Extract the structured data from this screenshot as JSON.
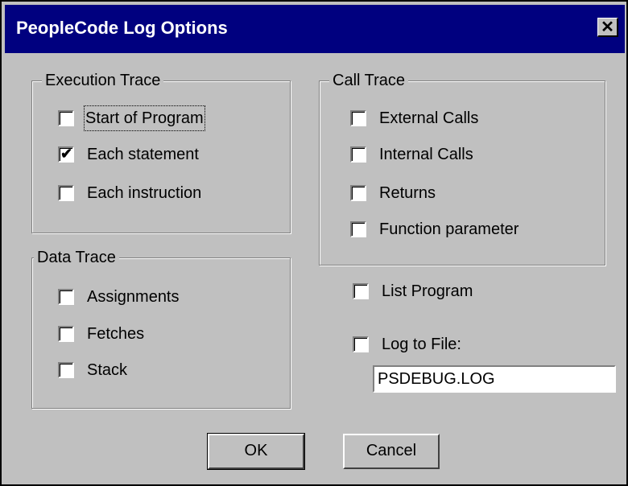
{
  "window": {
    "title": "PeopleCode Log Options",
    "close_glyph": "✕"
  },
  "execution_trace": {
    "legend": "Execution Trace",
    "items": [
      {
        "label": "Start of Program",
        "checked": false
      },
      {
        "label": "Each statement",
        "checked": true
      },
      {
        "label": "Each instruction",
        "checked": false
      }
    ]
  },
  "call_trace": {
    "legend": "Call Trace",
    "items": [
      {
        "label": "External Calls",
        "checked": false
      },
      {
        "label": "Internal Calls",
        "checked": false
      },
      {
        "label": "Returns",
        "checked": false
      },
      {
        "label": "Function parameter",
        "checked": false
      }
    ]
  },
  "data_trace": {
    "legend": "Data Trace",
    "items": [
      {
        "label": "Assignments",
        "checked": false
      },
      {
        "label": "Fetches",
        "checked": false
      },
      {
        "label": "Stack",
        "checked": false
      }
    ]
  },
  "list_program": {
    "label": "List Program",
    "checked": false
  },
  "log_to_file": {
    "label": "Log to File:",
    "checked": false,
    "value": "PSDEBUG.LOG"
  },
  "buttons": {
    "ok": "OK",
    "cancel": "Cancel"
  },
  "check_glyph": "✔"
}
